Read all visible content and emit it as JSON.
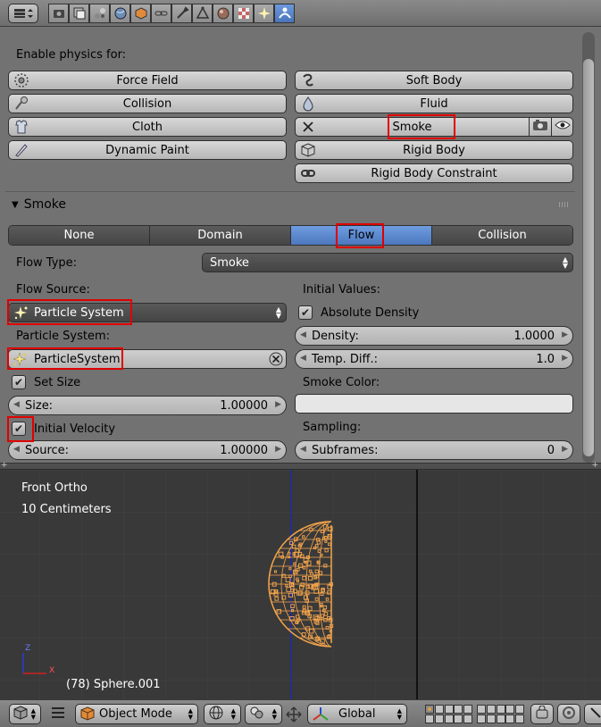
{
  "header": {
    "editor_type_icon": "properties-editor-icon",
    "context_tabs": [
      {
        "icon": "render-icon"
      },
      {
        "icon": "render-layers-icon"
      },
      {
        "icon": "scene-icon"
      },
      {
        "icon": "world-icon"
      },
      {
        "icon": "object-icon"
      },
      {
        "icon": "constraints-icon"
      },
      {
        "icon": "modifiers-icon"
      },
      {
        "icon": "mesh-data-icon"
      },
      {
        "icon": "material-icon"
      },
      {
        "icon": "texture-icon"
      },
      {
        "icon": "particles-icon"
      },
      {
        "icon": "physics-icon",
        "active": true
      }
    ]
  },
  "physics": {
    "enable_label": "Enable physics for:",
    "left_buttons": [
      {
        "label": "Force Field",
        "icon": "force-field-icon"
      },
      {
        "label": "Collision",
        "icon": "collision-icon"
      },
      {
        "label": "Cloth",
        "icon": "cloth-icon"
      },
      {
        "label": "Dynamic Paint",
        "icon": "dynamic-paint-icon"
      }
    ],
    "right_buttons": [
      {
        "label": "Soft Body",
        "icon": "soft-body-icon"
      },
      {
        "label": "Fluid",
        "icon": "fluid-icon"
      },
      {
        "label": "Smoke",
        "icon": "remove-x-icon"
      },
      {
        "label": "Rigid Body",
        "icon": "rigid-body-icon"
      },
      {
        "label": "Rigid Body Constraint",
        "icon": "rigid-body-constraint-icon"
      }
    ]
  },
  "smoke": {
    "panel_title": "Smoke",
    "type_tabs": [
      "None",
      "Domain",
      "Flow",
      "Collision"
    ],
    "selected_tab": "Flow",
    "flow_type_label": "Flow Type:",
    "flow_type_value": "Smoke",
    "flow_source_label": "Flow Source:",
    "flow_source_value": "Particle System",
    "particle_system_label": "Particle System:",
    "particle_system_value": "ParticleSystem",
    "set_size_label": "Set Size",
    "set_size_checked": true,
    "size_label": "Size:",
    "size_value": "1.00000",
    "initial_velocity_label": "Initial Velocity",
    "initial_velocity_checked": true,
    "source_label": "Source:",
    "source_value": "1.00000",
    "initial_values_label": "Initial Values:",
    "absolute_density_label": "Absolute Density",
    "absolute_density_checked": true,
    "density_label": "Density:",
    "density_value": "1.0000",
    "temp_diff_label": "Temp. Diff.:",
    "temp_diff_value": "1.0",
    "smoke_color_label": "Smoke Color:",
    "sampling_label": "Sampling:",
    "subframes_label": "Subframes:",
    "subframes_value": "0"
  },
  "viewport": {
    "view_name": "Front Ortho",
    "scale_text": "10 Centimeters",
    "object_text": "(78) Sphere.001",
    "axis_z": "Z",
    "axis_x": "X"
  },
  "view_header": {
    "mode_label": "Object Mode",
    "orientation_label": "Global"
  },
  "colors": {
    "highlight": "#e00000",
    "selected_tab": "#5a86cf",
    "mesh_wire": "#f7a64c"
  }
}
